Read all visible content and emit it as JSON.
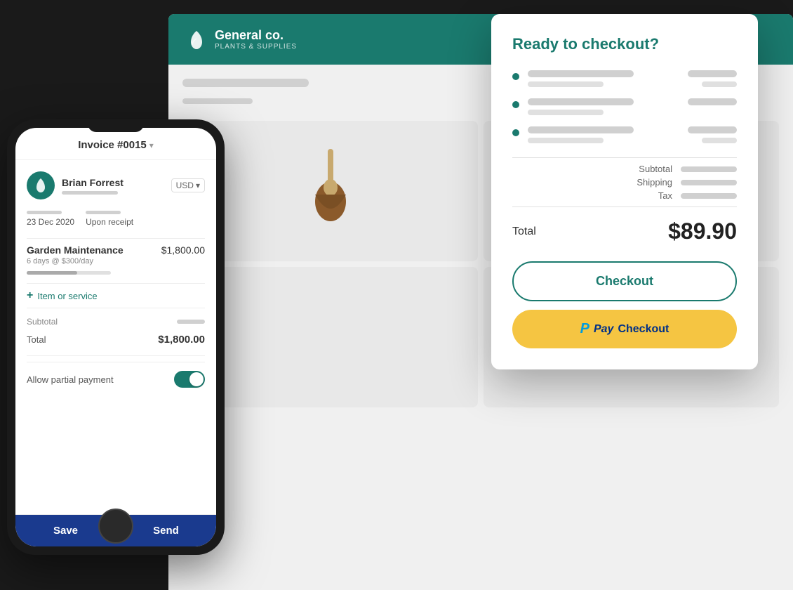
{
  "background": {
    "color": "#1a1a1a"
  },
  "desktop": {
    "header": {
      "company": "General co.",
      "tagline": "PLANTS & SUPPLIES",
      "progress_bar1_color": "#a0c8c0",
      "progress_bar2_color": "#1a7a6e"
    },
    "search_placeholder": ""
  },
  "checkout_modal": {
    "title": "Ready to checkout?",
    "items": [
      {
        "dot": true
      },
      {
        "dot": true
      },
      {
        "dot": true
      }
    ],
    "subtotal_label": "Subtotal",
    "shipping_label": "Shipping",
    "tax_label": "Tax",
    "total_label": "Total",
    "total_amount": "$89.90",
    "checkout_btn_label": "Checkout",
    "paypal_btn_label": "Checkout"
  },
  "phone": {
    "invoice_title": "Invoice #0015",
    "client_name": "Brian Forrest",
    "currency": "USD",
    "date": "23 Dec 2020",
    "due": "Upon receipt",
    "item_name": "Garden Maintenance",
    "item_price": "$1,800.00",
    "item_desc": "6 days @ $300/day",
    "add_item_label": "Item or service",
    "subtotal_label": "Subtotal",
    "total_label": "Total",
    "total_value": "$1,800.00",
    "partial_payment_label": "Allow partial payment",
    "save_label": "Save",
    "send_label": "Send"
  }
}
